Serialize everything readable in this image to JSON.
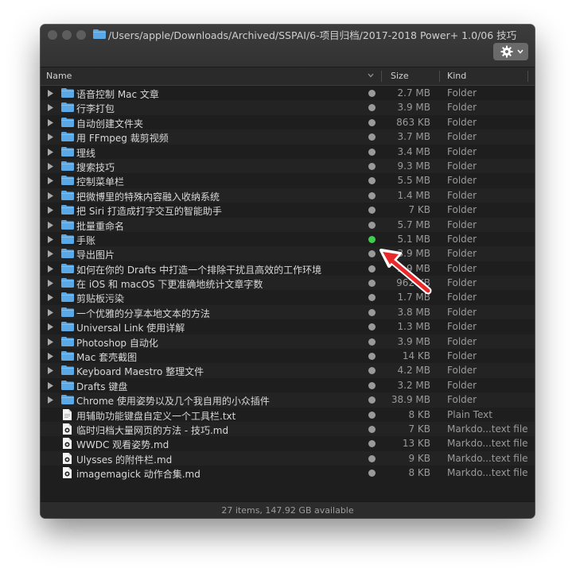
{
  "window": {
    "path": "/Users/apple/Downloads/Archived/SSPAI/6-项目归档/2017-2018 Power+ 1.0/06 技巧"
  },
  "columns": {
    "name": "Name",
    "size": "Size",
    "kind": "Kind"
  },
  "icons": {
    "folder": "folder-icon",
    "text_doc": "document-icon",
    "markdown_doc": "markdown-icon",
    "gear": "gear-icon",
    "disclosure": "disclosure-triangle-icon",
    "sort": "chevron-down-icon",
    "annotation": "red-arrow-annotation"
  },
  "colors": {
    "folder": "#5aa9e6",
    "tag_gray": "#9a9a9a",
    "tag_green": "#3ecf4a",
    "annotation": "#e8292c"
  },
  "rows": [
    {
      "name": "语音控制 Mac 文章",
      "size": "2.7 MB",
      "kind": "Folder",
      "type": "folder",
      "tag": "gray"
    },
    {
      "name": "行李打包",
      "size": "3.9 MB",
      "kind": "Folder",
      "type": "folder",
      "tag": "gray"
    },
    {
      "name": "自动创建文件夹",
      "size": "863 KB",
      "kind": "Folder",
      "type": "folder",
      "tag": "gray"
    },
    {
      "name": "用 FFmpeg 裁剪视频",
      "size": "3.7 MB",
      "kind": "Folder",
      "type": "folder",
      "tag": "gray"
    },
    {
      "name": "理线",
      "size": "3.4 MB",
      "kind": "Folder",
      "type": "folder",
      "tag": "gray"
    },
    {
      "name": "搜索技巧",
      "size": "9.3 MB",
      "kind": "Folder",
      "type": "folder",
      "tag": "gray"
    },
    {
      "name": "控制菜单栏",
      "size": "5.5 MB",
      "kind": "Folder",
      "type": "folder",
      "tag": "gray"
    },
    {
      "name": "把微博里的特殊内容融入收纳系统",
      "size": "1.4 MB",
      "kind": "Folder",
      "type": "folder",
      "tag": "gray"
    },
    {
      "name": "把 Siri 打造成打字交互的智能助手",
      "size": "7 KB",
      "kind": "Folder",
      "type": "folder",
      "tag": "gray"
    },
    {
      "name": "批量重命名",
      "size": "5.7 MB",
      "kind": "Folder",
      "type": "folder",
      "tag": "gray"
    },
    {
      "name": "手账",
      "size": "5.1 MB",
      "kind": "Folder",
      "type": "folder",
      "tag": "green"
    },
    {
      "name": "导出图片",
      "size": "3.9 MB",
      "kind": "Folder",
      "type": "folder",
      "tag": "gray"
    },
    {
      "name": "如何在你的 Drafts 中打造一个排除干扰且高效的工作环境",
      "size": "2.9 MB",
      "kind": "Folder",
      "type": "folder",
      "tag": "gray"
    },
    {
      "name": "在 iOS 和 macOS 下更准确地统计文章字数",
      "size": "962 KB",
      "kind": "Folder",
      "type": "folder",
      "tag": "gray"
    },
    {
      "name": "剪贴板污染",
      "size": "1.7 MB",
      "kind": "Folder",
      "type": "folder",
      "tag": "gray"
    },
    {
      "name": "一个优雅的分享本地文本的方法",
      "size": "3.8 MB",
      "kind": "Folder",
      "type": "folder",
      "tag": "gray"
    },
    {
      "name": "Universal Link 使用详解",
      "size": "1.3 MB",
      "kind": "Folder",
      "type": "folder",
      "tag": "gray"
    },
    {
      "name": "Photoshop 自动化",
      "size": "3.9 MB",
      "kind": "Folder",
      "type": "folder",
      "tag": "gray"
    },
    {
      "name": "Mac 套壳截图",
      "size": "14 KB",
      "kind": "Folder",
      "type": "folder",
      "tag": "gray"
    },
    {
      "name": "Keyboard Maestro 整理文件",
      "size": "4.2 MB",
      "kind": "Folder",
      "type": "folder",
      "tag": "gray"
    },
    {
      "name": "Drafts 键盘",
      "size": "3.2 MB",
      "kind": "Folder",
      "type": "folder",
      "tag": "gray"
    },
    {
      "name": "Chrome 使用姿势以及几个我自用的小众插件",
      "size": "38.9 MB",
      "kind": "Folder",
      "type": "folder",
      "tag": "gray"
    },
    {
      "name": "用辅助功能键盘自定义一个工具栏.txt",
      "size": "8 KB",
      "kind": "Plain Text",
      "type": "text",
      "tag": "gray"
    },
    {
      "name": "临时归档大量网页的方法 - 技巧.md",
      "size": "7 KB",
      "kind": "Markdo...text file",
      "type": "markdown",
      "tag": "gray"
    },
    {
      "name": "WWDC 观看姿势.md",
      "size": "13 KB",
      "kind": "Markdo...text file",
      "type": "markdown",
      "tag": "gray"
    },
    {
      "name": "Ulysses 的附件栏.md",
      "size": "9 KB",
      "kind": "Markdo...text file",
      "type": "markdown",
      "tag": "gray"
    },
    {
      "name": "imagemagick 动作合集.md",
      "size": "8 KB",
      "kind": "Markdo...text file",
      "type": "markdown",
      "tag": "gray"
    }
  ],
  "status": "27 items, 147.92 GB available"
}
